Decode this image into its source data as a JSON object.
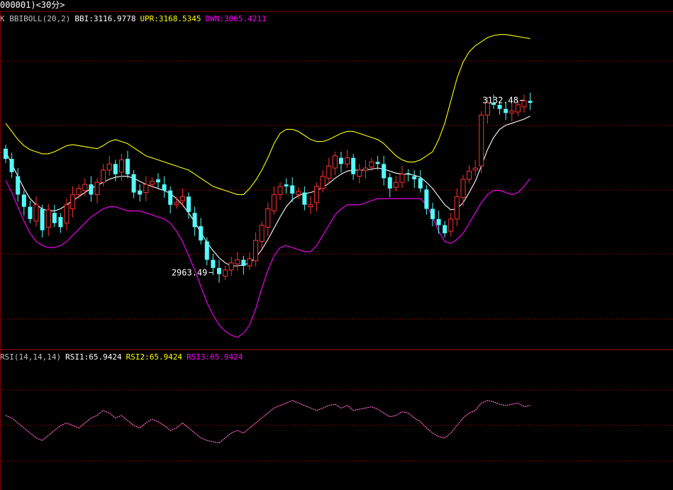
{
  "window": {
    "title": "000001)<30分>"
  },
  "main_panel": {
    "indicator": "K  BBIBOLL(20,2)",
    "values": [
      {
        "label": "BBI:3116.9778",
        "color": "#ffffff"
      },
      {
        "label": "UPR:3168.5345",
        "color": "#ffff00"
      },
      {
        "label": "DWN:3065.4211",
        "color": "#ff00ff"
      }
    ]
  },
  "rsi_panel": {
    "indicator": "RSI(14,14,14)",
    "values": [
      {
        "label": "RSI1:65.9424",
        "color": "#ffffff"
      },
      {
        "label": "RSI2:65.9424",
        "color": "#ffff00"
      },
      {
        "label": "RSI3:65.9424",
        "color": "#ff00ff"
      }
    ]
  },
  "chart_data": [
    {
      "type": "candlestick",
      "title": "",
      "ylim": [
        2890,
        3210
      ],
      "colors": {
        "up": "#ff3232",
        "down": "#54fcfc",
        "bbi": "#ffffff",
        "upr": "#ffff00",
        "dwn": "#ff00ff",
        "grid": "#800000"
      },
      "annotations": [
        {
          "text": "3132.48",
          "index": 85,
          "value": 3132.48
        },
        {
          "text": "2963.49",
          "index": 34,
          "value": 2963.49
        }
      ],
      "close": [
        3075,
        3062,
        3040,
        3028,
        3016,
        3030,
        3005,
        3025,
        3012,
        3008,
        3030,
        3040,
        3046,
        3050,
        3040,
        3052,
        3064,
        3070,
        3060,
        3074,
        3060,
        3042,
        3040,
        3050,
        3053,
        3052,
        3044,
        3030,
        3032,
        3038,
        3023,
        3008,
        2995,
        2976,
        2968,
        2962,
        2966,
        2973,
        2976,
        2970,
        2977,
        2995,
        3010,
        3026,
        3040,
        3048,
        3048,
        3041,
        3043,
        3030,
        3030,
        3048,
        3058,
        3068,
        3078,
        3070,
        3076,
        3060,
        3064,
        3066,
        3072,
        3070,
        3056,
        3046,
        3052,
        3060,
        3060,
        3055,
        3046,
        3026,
        3016,
        3010,
        3002,
        3016,
        3038,
        3055,
        3063,
        3066,
        3118,
        3130,
        3128,
        3124,
        3120,
        3122,
        3128,
        3132,
        3130
      ],
      "open": [
        3085,
        3075,
        3058,
        3040,
        3028,
        3014,
        3026,
        3008,
        3022,
        3018,
        3012,
        3026,
        3040,
        3044,
        3050,
        3040,
        3052,
        3064,
        3070,
        3062,
        3075,
        3060,
        3044,
        3042,
        3050,
        3055,
        3050,
        3044,
        3030,
        3034,
        3038,
        3022,
        3009,
        2994,
        2976,
        2968,
        2960,
        2966,
        2972,
        2976,
        2970,
        2975,
        2994,
        3008,
        3024,
        3040,
        3050,
        3049,
        3040,
        3042,
        3028,
        3032,
        3046,
        3056,
        3066,
        3076,
        3070,
        3076,
        3058,
        3064,
        3067,
        3072,
        3070,
        3057,
        3047,
        3052,
        3061,
        3058,
        3056,
        3045,
        3026,
        3016,
        3010,
        3004,
        3016,
        3037,
        3055,
        3064,
        3068,
        3118,
        3130,
        3128,
        3124,
        3120,
        3121,
        3126,
        3132
      ],
      "bbi": [
        3082,
        3070,
        3058,
        3046,
        3036,
        3030,
        3026,
        3024,
        3024,
        3026,
        3030,
        3034,
        3038,
        3042,
        3046,
        3049,
        3052,
        3055,
        3057,
        3058,
        3058,
        3056,
        3053,
        3050,
        3048,
        3046,
        3044,
        3041,
        3036,
        3030,
        3022,
        3013,
        3003,
        2993,
        2985,
        2978,
        2973,
        2970,
        2970,
        2971,
        2973,
        2978,
        2986,
        2996,
        3007,
        3018,
        3028,
        3035,
        3039,
        3041,
        3042,
        3044,
        3047,
        3051,
        3056,
        3060,
        3063,
        3064,
        3064,
        3064,
        3065,
        3066,
        3065,
        3063,
        3061,
        3060,
        3060,
        3059,
        3057,
        3052,
        3046,
        3038,
        3030,
        3025,
        3026,
        3032,
        3042,
        3053,
        3068,
        3084,
        3096,
        3104,
        3108,
        3110,
        3112,
        3114,
        3117
      ],
      "upr": [
        3110,
        3102,
        3094,
        3088,
        3084,
        3082,
        3080,
        3080,
        3082,
        3085,
        3088,
        3089,
        3088,
        3087,
        3086,
        3085,
        3088,
        3092,
        3094,
        3092,
        3090,
        3086,
        3082,
        3078,
        3076,
        3074,
        3072,
        3070,
        3068,
        3066,
        3064,
        3060,
        3056,
        3052,
        3048,
        3046,
        3044,
        3042,
        3040,
        3040,
        3046,
        3054,
        3064,
        3076,
        3090,
        3100,
        3104,
        3104,
        3102,
        3098,
        3094,
        3092,
        3092,
        3094,
        3097,
        3100,
        3102,
        3102,
        3100,
        3098,
        3096,
        3094,
        3090,
        3084,
        3078,
        3074,
        3072,
        3072,
        3074,
        3078,
        3082,
        3094,
        3110,
        3132,
        3154,
        3170,
        3180,
        3186,
        3190,
        3194,
        3196,
        3197,
        3197,
        3196,
        3195,
        3194,
        3193
      ],
      "dwn": [
        3054,
        3042,
        3028,
        3014,
        3002,
        2994,
        2990,
        2988,
        2988,
        2990,
        2994,
        3000,
        3006,
        3012,
        3018,
        3022,
        3026,
        3028,
        3028,
        3026,
        3024,
        3024,
        3024,
        3022,
        3020,
        3018,
        3016,
        3012,
        3004,
        2994,
        2980,
        2966,
        2950,
        2934,
        2922,
        2912,
        2906,
        2902,
        2900,
        2904,
        2912,
        2928,
        2948,
        2966,
        2980,
        2988,
        2990,
        2988,
        2986,
        2984,
        2984,
        2990,
        3000,
        3010,
        3020,
        3026,
        3030,
        3030,
        3030,
        3032,
        3034,
        3036,
        3036,
        3036,
        3036,
        3036,
        3036,
        3036,
        3036,
        3030,
        3018,
        3004,
        2994,
        2992,
        2996,
        3002,
        3012,
        3022,
        3032,
        3040,
        3044,
        3044,
        3042,
        3040,
        3042,
        3048,
        3056
      ]
    },
    {
      "type": "line",
      "title": "",
      "ylim": [
        0,
        100
      ],
      "series": [
        {
          "name": "RSI1",
          "color": "#ff66cc",
          "values": [
            58,
            56,
            52,
            48,
            44,
            40,
            38,
            42,
            46,
            50,
            52,
            50,
            48,
            52,
            56,
            58,
            62,
            60,
            56,
            58,
            54,
            50,
            48,
            52,
            55,
            53,
            50,
            46,
            48,
            52,
            48,
            44,
            40,
            38,
            37,
            36,
            40,
            44,
            46,
            44,
            48,
            52,
            56,
            60,
            64,
            66,
            68,
            70,
            68,
            66,
            64,
            62,
            64,
            66,
            67,
            64,
            66,
            62,
            63,
            64,
            65,
            63,
            60,
            57,
            58,
            61,
            60,
            56,
            53,
            48,
            44,
            41,
            40,
            44,
            50,
            56,
            60,
            62,
            68,
            70,
            69,
            67,
            66,
            67,
            68,
            65,
            66
          ]
        }
      ]
    }
  ]
}
